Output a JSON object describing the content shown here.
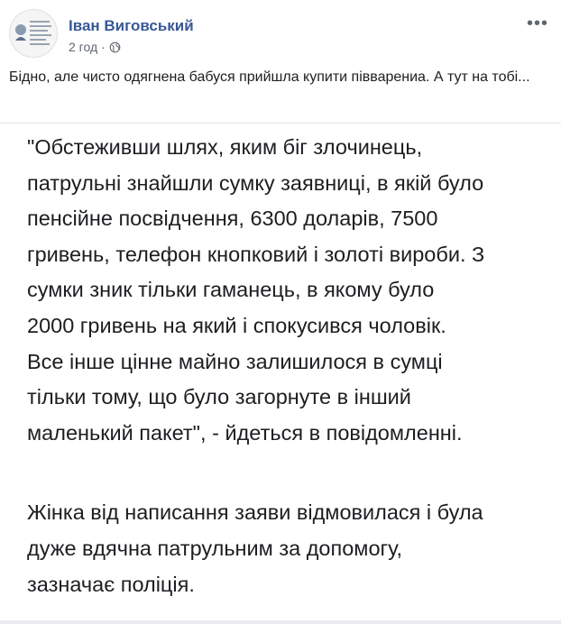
{
  "post": {
    "author_name": "Іван Виговський",
    "timestamp": "2 год",
    "separator": "·",
    "privacy_icon": "globe-icon",
    "more_icon": "more-options-icon",
    "caption": "Бідно, але чисто одягнена бабуся прийшла купити півварениа. А тут на тобі..."
  },
  "image_text": {
    "quote": "\"Обстеживши шлях, яким біг злочинець,\nпатрульні знайшли сумку заявниці, в якій було\nпенсійне посвідчення, 6300 доларів, 7500\nгривень, телефон кнопковий і золоті вироби. З\nсумки зник тільки гаманець, в якому було\n2000 гривень  на який і спокусився чоловік.\nВсе інше цінне майно залишилося в сумці\nтільки тому, що було загорнуте в інший\nмаленький пакет\", - йдеться в повідомленні.",
    "paragraph2": "Жінка від написання заяви відмовилася і була\nдуже вдячна патрульним за допомогу,\nзазначає поліція."
  },
  "colors": {
    "author_link": "#385898",
    "meta_text": "#616770",
    "body_text": "#1c1e21"
  }
}
